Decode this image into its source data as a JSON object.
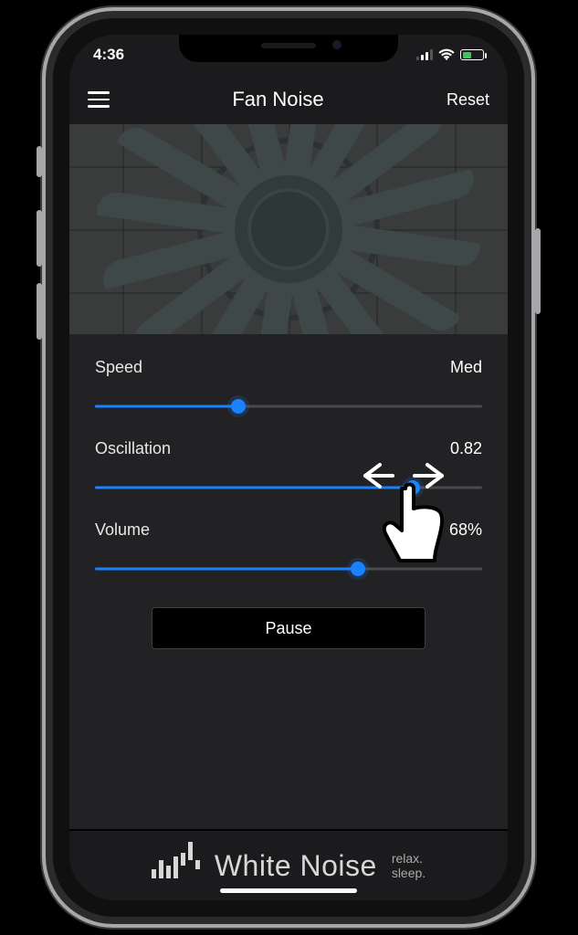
{
  "status": {
    "time": "4:36"
  },
  "nav": {
    "title": "Fan Noise",
    "reset": "Reset"
  },
  "controls": {
    "speed": {
      "label": "Speed",
      "valueText": "Med",
      "fraction": 0.37
    },
    "oscillation": {
      "label": "Oscillation",
      "valueText": "0.82",
      "fraction": 0.82
    },
    "volume": {
      "label": "Volume",
      "valueText": "68%",
      "fraction": 0.68
    }
  },
  "buttons": {
    "pause": "Pause"
  },
  "footer": {
    "brand": "White Noise",
    "tag1": "relax.",
    "tag2": "sleep."
  },
  "colors": {
    "accent": "#1a82ff",
    "panel": "#222224",
    "screen": "#1b1b1d"
  }
}
